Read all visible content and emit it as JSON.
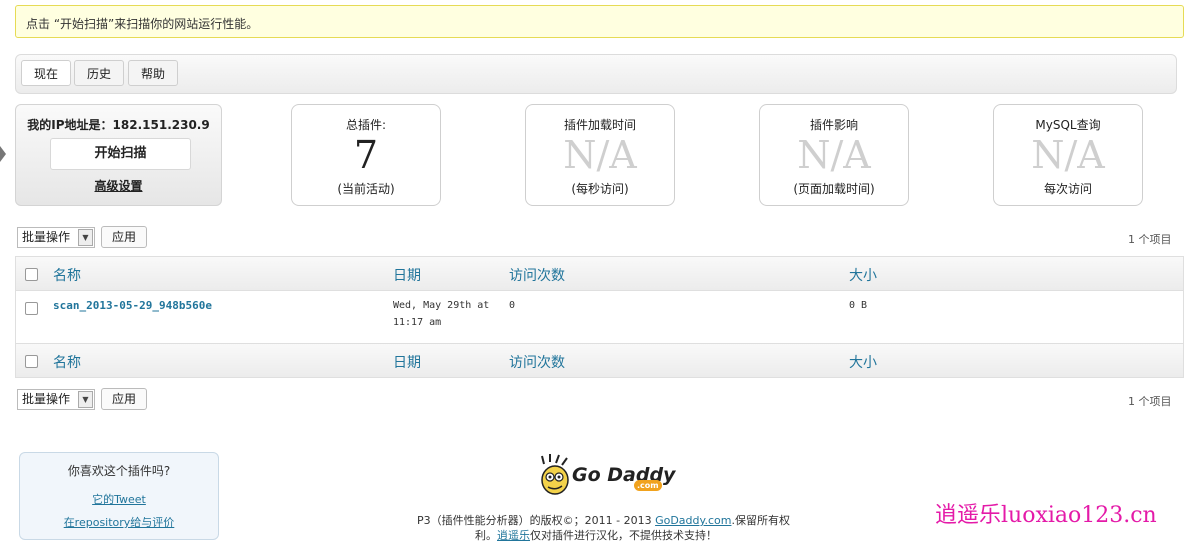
{
  "notice": "点击 “开始扫描”来扫描你的网站运行性能。",
  "tabs": [
    "现在",
    "历史",
    "帮助"
  ],
  "scan": {
    "ip_label": "我的IP地址是：182.151.230.9",
    "start_button": "开始扫描",
    "advanced": "高级设置"
  },
  "stats": [
    {
      "title": "总插件:",
      "value": "7",
      "sub": "(当前活动)"
    },
    {
      "title": "插件加载时间",
      "value": "N/A",
      "sub": "(每秒访问)"
    },
    {
      "title": "插件影响",
      "value": "N/A",
      "sub": "(页面加载时间)"
    },
    {
      "title": "MySQL查询",
      "value": "N/A",
      "sub": "每次访问"
    }
  ],
  "bulk": {
    "label": "批量操作",
    "apply": "应用",
    "count": "1 个项目"
  },
  "table": {
    "headers": [
      "名称",
      "日期",
      "访问次数",
      "大小"
    ],
    "rows": [
      {
        "name": "scan_2013-05-29_948b560e",
        "date_line1": "Wed, May 29th at",
        "date_line2": "11:17 am",
        "visits": "0",
        "size": "0 B"
      }
    ]
  },
  "likebox": {
    "question": "你喜欢这个插件吗?",
    "tweet": "它的Tweet",
    "rate": "在repository给与评价"
  },
  "footer": {
    "logo_text": "Go Daddy",
    "logo_com": ".com",
    "line1_a": "P3（插件性能分析器）的版权©；2011 - 2013 ",
    "line1_link": "GoDaddy.com",
    "line1_b": ".保留所有权",
    "line2_a": "利。",
    "line2_link": "逍遥乐",
    "line2_b": "仅对插件进行汉化，不提供技术支持！"
  },
  "watermark": "逍遥乐luoxiao123.cn",
  "colors": {
    "link": "#21759b",
    "watermark": "#e41aa8",
    "notice_bg": "#ffffe0"
  }
}
